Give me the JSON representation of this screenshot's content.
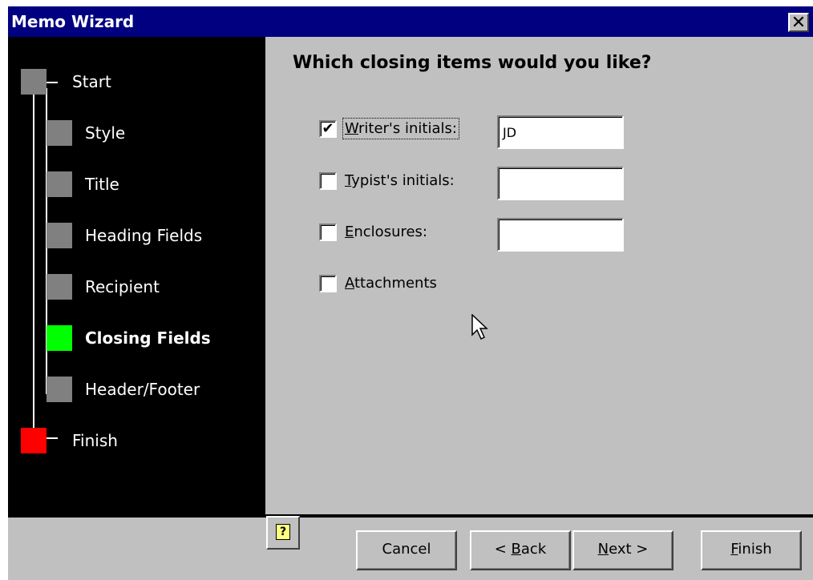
{
  "window": {
    "title": "Memo Wizard",
    "close_glyph": "✕"
  },
  "steps": [
    {
      "label": "Start"
    },
    {
      "label": "Style"
    },
    {
      "label": "Title"
    },
    {
      "label": "Heading Fields"
    },
    {
      "label": "Recipient"
    },
    {
      "label": "Closing Fields"
    },
    {
      "label": "Header/Footer"
    },
    {
      "label": "Finish"
    }
  ],
  "current_step": "Closing Fields",
  "main": {
    "question": "Which closing items would you like?",
    "options": [
      {
        "pre": "",
        "accel": "W",
        "post": "riter's initials:",
        "checked": true,
        "value": "JD"
      },
      {
        "pre": "",
        "accel": "T",
        "post": "ypist's initials:",
        "checked": false,
        "value": ""
      },
      {
        "pre": "",
        "accel": "E",
        "post": "nclosures:",
        "checked": false,
        "value": ""
      },
      {
        "pre": "",
        "accel": "A",
        "post": "ttachments",
        "checked": false
      }
    ]
  },
  "buttons": {
    "help_glyph": "?",
    "cancel": "Cancel",
    "back_pre": "< ",
    "back_accel": "B",
    "back_post": "ack",
    "next_accel": "N",
    "next_post": "ext >",
    "finish_accel": "F",
    "finish_post": "inish"
  },
  "colors": {
    "title_bar": "#000080",
    "panel": "#000000",
    "step_box": "#808080",
    "current_step_box": "#00ff00",
    "finish_step_box": "#ff0000",
    "dialog_face": "#c0c0c0"
  },
  "icons": {
    "help": "help-icon",
    "close": "close-icon",
    "cursor": "mouse-pointer-icon",
    "check": "checkmark-icon"
  }
}
